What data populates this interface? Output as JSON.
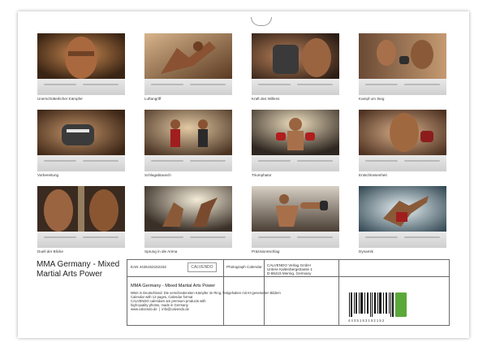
{
  "thumbnails": [
    {
      "caption": "Unerschütterlicher Kämpfer"
    },
    {
      "caption": "Luftangriff"
    },
    {
      "caption": "Kraft des Willens"
    },
    {
      "caption": "Kampf um Sieg"
    },
    {
      "caption": "Vorbereitung"
    },
    {
      "caption": "Schlagabtausch"
    },
    {
      "caption": "Triumphator"
    },
    {
      "caption": "Entschlossenheit"
    },
    {
      "caption": "Duell der Blicke"
    },
    {
      "caption": "Sprung in die Arena"
    },
    {
      "caption": "Präzisionsschlag"
    },
    {
      "caption": "Dynamik"
    }
  ],
  "product_title": "MMA Germany - Mixed Martial Arts Power",
  "info": {
    "publisher_logo": "CALVENDO",
    "ean_label": "EAN 4435153152152",
    "product_name": "MMA Germany - Mixed Martial Arts Power",
    "product_code": "Photograph Calendar",
    "publisher_address": "CALVENDO Verlag GmbH\nUntere Kaltenbergstrasse 1\nD-86415 Mering, Germany",
    "description": "MMA in Deutschland: Die verschiedensten Kämpfer im Ring, festgehalten mit KI-generierten Bildern\nCalendar with 13 pages, Calendar format\nCALVENDO calendars are premium products with\nhigh-quality photos, made in Germany.\nwww.calvendo.de  |  info@calvendo.de",
    "barcode_number": "4 4 3 5 1 5 3 1 5 2 1 5 2"
  },
  "colors": {
    "badge": "#5aa83a",
    "border": "#6a6a6a"
  }
}
